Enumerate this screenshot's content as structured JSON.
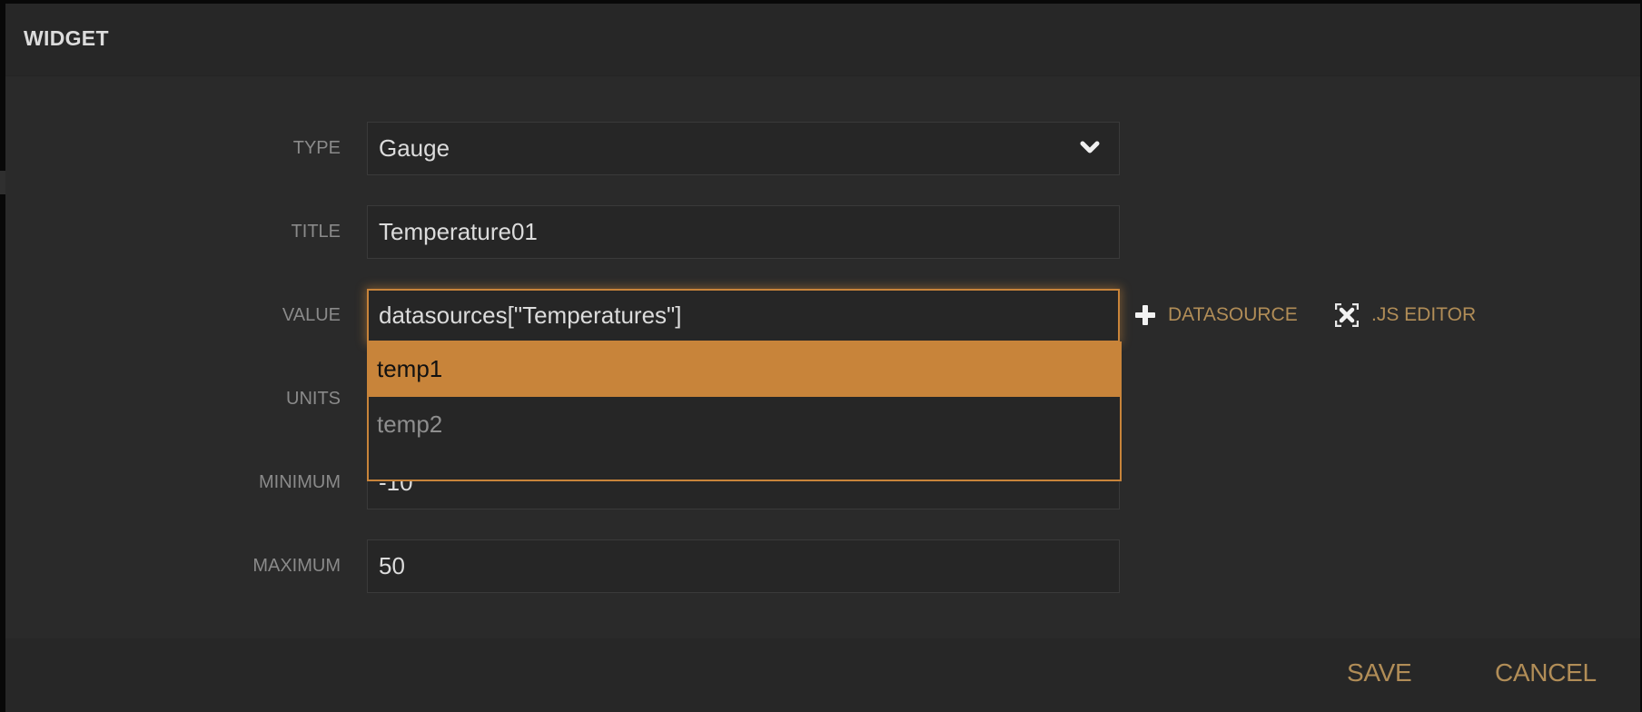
{
  "dialog": {
    "title": "WIDGET"
  },
  "form": {
    "type": {
      "label": "TYPE",
      "value": "Gauge"
    },
    "title": {
      "label": "TITLE",
      "value": "Temperature01"
    },
    "value": {
      "label": "VALUE",
      "value": "datasources[\"Temperatures\"]",
      "actions": {
        "datasource": {
          "label": "DATASOURCE",
          "icon": "plus-icon"
        },
        "js_editor": {
          "label": ".JS EDITOR",
          "icon": "expand-icon"
        }
      },
      "autocomplete": [
        {
          "label": "temp1",
          "highlighted": true
        },
        {
          "label": "temp2",
          "highlighted": false
        }
      ]
    },
    "units": {
      "label": "UNITS",
      "value": ""
    },
    "minimum": {
      "label": "MINIMUM",
      "value": "-10"
    },
    "maximum": {
      "label": "MAXIMUM",
      "value": "50"
    }
  },
  "footer": {
    "save_label": "SAVE",
    "cancel_label": "CANCEL"
  },
  "colors": {
    "accent": "#c8843a",
    "link": "#b18d57",
    "background": "#2a2a2a"
  }
}
